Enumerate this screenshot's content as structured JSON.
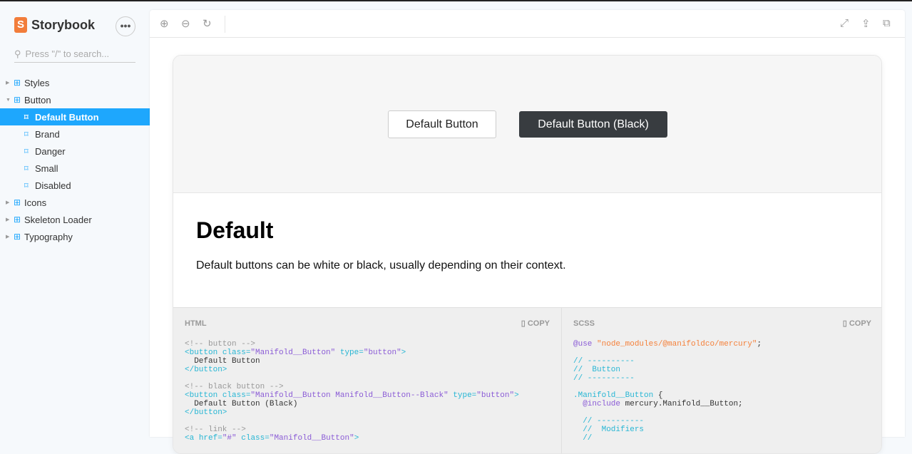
{
  "app": {
    "title": "Storybook",
    "more_label": "•••",
    "search_placeholder": "Press \"/\" to search..."
  },
  "sidebar": {
    "items": [
      {
        "label": "Styles",
        "type": "group",
        "expanded": false
      },
      {
        "label": "Button",
        "type": "group",
        "expanded": true
      },
      {
        "label": "Default Button",
        "type": "story",
        "selected": true
      },
      {
        "label": "Brand",
        "type": "story"
      },
      {
        "label": "Danger",
        "type": "story"
      },
      {
        "label": "Small",
        "type": "story"
      },
      {
        "label": "Disabled",
        "type": "story"
      },
      {
        "label": "Icons",
        "type": "group",
        "expanded": false
      },
      {
        "label": "Skeleton Loader",
        "type": "group",
        "expanded": false
      },
      {
        "label": "Typography",
        "type": "group",
        "expanded": false
      }
    ]
  },
  "toolbar": {
    "zoom_in": "⊕",
    "zoom_out": "⊖",
    "reset": "↻",
    "fullscreen": "⤢",
    "share": "⇪",
    "copy": "⧉"
  },
  "preview": {
    "default_button": "Default Button",
    "black_button": "Default Button (Black)"
  },
  "docs": {
    "title": "Default",
    "description": "Default buttons can be white or black, usually depending on their context."
  },
  "code": {
    "html": {
      "title": "HTML",
      "copy_label": "COPY",
      "lines": [
        [
          [
            "cm",
            "<!-- button -->"
          ]
        ],
        [
          [
            "tg",
            "<button "
          ],
          [
            "at",
            "class="
          ],
          [
            "st",
            "\"Manifold__Button\""
          ],
          [
            "at",
            " type="
          ],
          [
            "st",
            "\"button\""
          ],
          [
            "tg",
            ">"
          ]
        ],
        [
          [
            "tx",
            "  Default Button"
          ]
        ],
        [
          [
            "tg",
            "</button>"
          ]
        ],
        [],
        [
          [
            "cm",
            "<!-- black button -->"
          ]
        ],
        [
          [
            "tg",
            "<button "
          ],
          [
            "at",
            "class="
          ],
          [
            "st",
            "\"Manifold__Button Manifold__Button--Black\""
          ],
          [
            "at",
            " type="
          ],
          [
            "st",
            "\"button\""
          ],
          [
            "tg",
            ">"
          ]
        ],
        [
          [
            "tx",
            "  Default Button (Black)"
          ]
        ],
        [
          [
            "tg",
            "</button>"
          ]
        ],
        [],
        [
          [
            "cm",
            "<!-- link -->"
          ]
        ],
        [
          [
            "tg",
            "<a "
          ],
          [
            "at",
            "href="
          ],
          [
            "st",
            "\"#\""
          ],
          [
            "at",
            " class="
          ],
          [
            "st",
            "\"Manifold__Button\""
          ],
          [
            "tg",
            ">"
          ]
        ]
      ]
    },
    "scss": {
      "title": "SCSS",
      "copy_label": "COPY",
      "lines": [
        [
          [
            "kw",
            "@use "
          ],
          [
            "str",
            "\"node_modules/@manifoldco/mercury\""
          ],
          [
            "tx",
            ";"
          ]
        ],
        [],
        [
          [
            "tg",
            "// ----------"
          ]
        ],
        [
          [
            "tg",
            "//  Button"
          ]
        ],
        [
          [
            "tg",
            "// ----------"
          ]
        ],
        [],
        [
          [
            "tg",
            ".Manifold__Button"
          ],
          [
            "tx",
            " {"
          ]
        ],
        [
          [
            "kw",
            "  @include"
          ],
          [
            "tx",
            " mercury.Manifold__Button;"
          ]
        ],
        [],
        [
          [
            "tg",
            "  // ----------"
          ]
        ],
        [
          [
            "tg",
            "  //  Modifiers"
          ]
        ],
        [
          [
            "tg",
            "  //"
          ]
        ]
      ]
    }
  },
  "colors": {
    "accent": "#1ea7fd",
    "black_button": "#383c40",
    "brand": "#f27d3b"
  }
}
